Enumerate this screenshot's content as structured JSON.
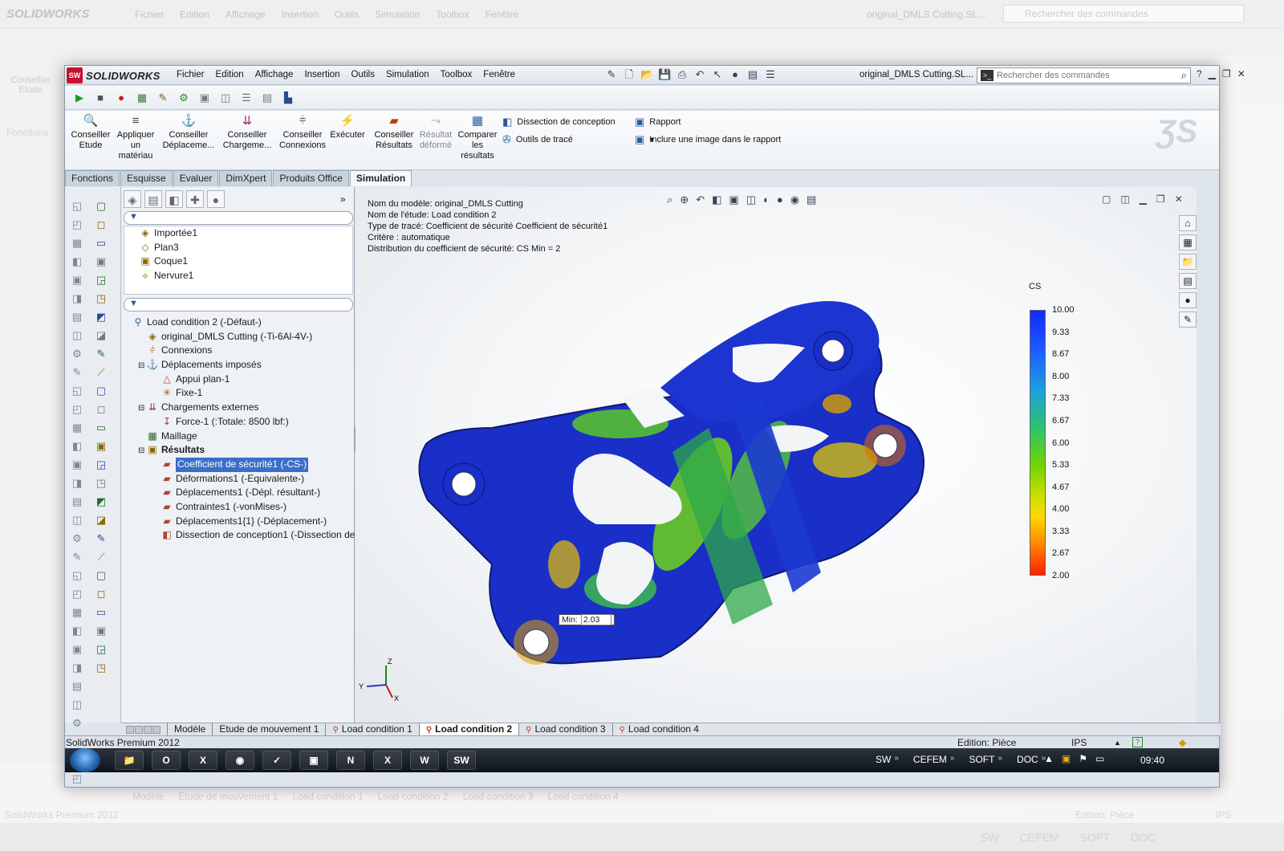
{
  "app": {
    "logo_text": "SOLIDWORKS",
    "logo_badge": "SW",
    "menu": [
      "Fichier",
      "Edition",
      "Affichage",
      "Insertion",
      "Outils",
      "Simulation",
      "Toolbox",
      "Fenêtre"
    ],
    "doc_title": "original_DMLS Cutting.SL...",
    "search_placeholder": "Rechercher des commandes"
  },
  "background_window": {
    "logo_text": "SOLIDWORKS",
    "menu": [
      "Fichier",
      "Edition",
      "Affichage",
      "Insertion",
      "Outils",
      "Simulation",
      "Toolbox",
      "Fenêtre"
    ],
    "doc_title": "original_DMLS Cutting.SL...",
    "search_placeholder": "Rechercher des commandes",
    "advisor_label": "Conseiller Etude",
    "fonctions_label": "Fonctions",
    "tabs": [
      "Modèle",
      "Etude de mouvement 1",
      "Load condition 1",
      "Load condition 2",
      "Load condition 3",
      "Load condition 4"
    ],
    "status_left": "SolidWorks Premium 2012",
    "status_edition": "Edition: Pièce",
    "status_units": "IPS",
    "tray": [
      "SW",
      "CEFEM",
      "SOFT",
      "DOC"
    ]
  },
  "command_manager": {
    "buttons": [
      {
        "label": "Conseiller Etude",
        "icon": "advisor-icon"
      },
      {
        "label": "Appliquer un matériau",
        "icon": "material-icon"
      },
      {
        "label": "Conseiller Déplaceme...",
        "icon": "fixture-icon"
      },
      {
        "label": "Conseiller Chargeme...",
        "icon": "load-icon"
      },
      {
        "label": "Conseiller Connexions",
        "icon": "connection-icon"
      },
      {
        "label": "Exécuter",
        "icon": "run-icon"
      },
      {
        "label": "Conseiller Résultats",
        "icon": "results-icon"
      },
      {
        "label": "Résultat déformé",
        "icon": "deformed-icon"
      },
      {
        "label": "Comparer les résultats",
        "icon": "compare-icon"
      }
    ],
    "rows": [
      {
        "label": "Dissection de conception",
        "icon": "design-study-icon"
      },
      {
        "label": "Outils de tracé",
        "icon": "plot-tools-icon"
      },
      {
        "label": "Rapport",
        "icon": "report-icon"
      },
      {
        "label": "Inclure une image dans le rapport",
        "icon": "include-image-icon"
      }
    ],
    "tabs": [
      "Fonctions",
      "Esquisse",
      "Evaluer",
      "DimXpert",
      "Produits Office",
      "Simulation"
    ],
    "active_tab": "Simulation"
  },
  "feature_tree_top": [
    {
      "label": "Importée1",
      "icon": "imported-icon"
    },
    {
      "label": "Plan3",
      "icon": "plane-icon"
    },
    {
      "label": "Coque1",
      "icon": "shell-icon"
    },
    {
      "label": "Nervure1",
      "icon": "rib-icon"
    }
  ],
  "study_tree": [
    {
      "label": "Load condition 2 (-Défaut-)",
      "icon": "study-icon",
      "level": 0,
      "toggle": ""
    },
    {
      "label": "original_DMLS Cutting (-Ti-6Al-4V-)",
      "icon": "part-icon",
      "level": 1,
      "toggle": ""
    },
    {
      "label": "Connexions",
      "icon": "connections-icon",
      "level": 1,
      "toggle": ""
    },
    {
      "label": "Déplacements imposés",
      "icon": "fixtures-icon",
      "level": 1,
      "toggle": "⊟"
    },
    {
      "label": "Appui plan-1",
      "icon": "roller-icon",
      "level": 2,
      "toggle": ""
    },
    {
      "label": "Fixe-1",
      "icon": "fixed-icon",
      "level": 2,
      "toggle": ""
    },
    {
      "label": "Chargements externes",
      "icon": "loads-icon",
      "level": 1,
      "toggle": "⊟"
    },
    {
      "label": "Force-1 (:Totale: 8500 lbf:)",
      "icon": "force-icon",
      "level": 2,
      "toggle": ""
    },
    {
      "label": "Maillage",
      "icon": "mesh-icon",
      "level": 1,
      "toggle": ""
    },
    {
      "label": "Résultats",
      "icon": "results-folder-icon",
      "level": 1,
      "toggle": "⊟",
      "bold": true
    },
    {
      "label": "Coefficient de sécurité1 (-CS-)",
      "icon": "fos-plot-icon",
      "level": 2,
      "toggle": "",
      "selected": true
    },
    {
      "label": "Déformations1 (-Equivalente-)",
      "icon": "strain-plot-icon",
      "level": 2,
      "toggle": ""
    },
    {
      "label": "Déplacements1 (-Dépl. résultant-)",
      "icon": "disp-plot-icon",
      "level": 2,
      "toggle": ""
    },
    {
      "label": "Contraintes1 (-vonMises-)",
      "icon": "stress-plot-icon",
      "level": 2,
      "toggle": ""
    },
    {
      "label": "Déplacements1{1} (-Déplacement-)",
      "icon": "disp-plot-icon",
      "level": 2,
      "toggle": ""
    },
    {
      "label": "Dissection de conception1 (-Dissection de co",
      "icon": "design-study-plot-icon",
      "level": 2,
      "toggle": ""
    }
  ],
  "plot_info": [
    "Nom du modèle: original_DMLS Cutting",
    "Nom de l'étude: Load condition 2",
    "Type de tracé: Coefficient de sécurité Coefficient de sécurité1",
    "Critère : automatique",
    "Distribution du coefficient de sécurité: CS Min = 2"
  ],
  "legend": {
    "title": "CS",
    "ticks": [
      "10.00",
      "9.33",
      "8.67",
      "8.00",
      "7.33",
      "6.67",
      "6.00",
      "5.33",
      "4.67",
      "4.00",
      "3.33",
      "2.67",
      "2.00"
    ],
    "color_top": "#1428ff",
    "color_bottom": "#ff2000"
  },
  "min_probe": {
    "label": "Min:",
    "value": "2.03"
  },
  "triad": {
    "x": "X",
    "y": "Y",
    "z": "Z"
  },
  "bottom_tabs": [
    {
      "label": "Modèle",
      "active": false
    },
    {
      "label": "Etude de mouvement 1",
      "active": false
    },
    {
      "label": "Load condition 1",
      "active": false
    },
    {
      "label": "Load condition 2",
      "active": true
    },
    {
      "label": "Load condition 3",
      "active": false
    },
    {
      "label": "Load condition 4",
      "active": false
    }
  ],
  "status": {
    "left": "SolidWorks Premium 2012",
    "edition": "Edition: Pièce",
    "units": "IPS"
  },
  "taskbar": {
    "apps": [
      "folder-icon",
      "outlook-icon",
      "excel-icon",
      "firefox-icon",
      "app-icon",
      "network-icon",
      "onenote-icon",
      "excel-icon",
      "word-icon",
      "solidworks-icon"
    ],
    "app_glyphs": [
      "📁",
      "O",
      "X",
      "◉",
      "✓",
      "▣",
      "N",
      "X",
      "W",
      "SW"
    ],
    "tray": [
      "SW",
      "CEFEM",
      "SOFT",
      "DOC"
    ],
    "clock": "09:40"
  }
}
